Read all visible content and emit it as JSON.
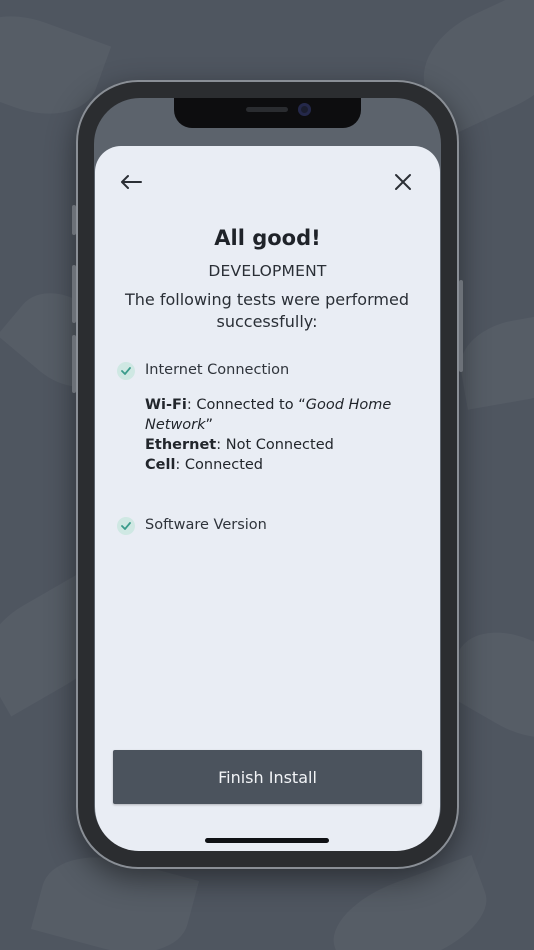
{
  "header": {
    "back_icon": "arrow-left-icon",
    "close_icon": "close-icon"
  },
  "content": {
    "title": "All good!",
    "environment": "DEVELOPMENT",
    "description": "The following tests were performed successfully:",
    "tests": [
      {
        "label": "Internet Connection",
        "details": [
          {
            "key": "Wi-Fi",
            "sep": ": Connected to “",
            "value": "Good Home Network",
            "end": "”"
          },
          {
            "key": "Ethernet",
            "sep": ": ",
            "value": "Not Connected",
            "end": ""
          },
          {
            "key": "Cell",
            "sep": ": ",
            "value": "Connected",
            "end": ""
          }
        ]
      },
      {
        "label": "Software Version"
      }
    ]
  },
  "footer": {
    "finish_label": "Finish Install"
  },
  "colors": {
    "check_bg": "#cfe8e3",
    "check_mark": "#3b9c8c",
    "button_bg": "#4b535d",
    "sheet_bg": "#e9edf4"
  }
}
